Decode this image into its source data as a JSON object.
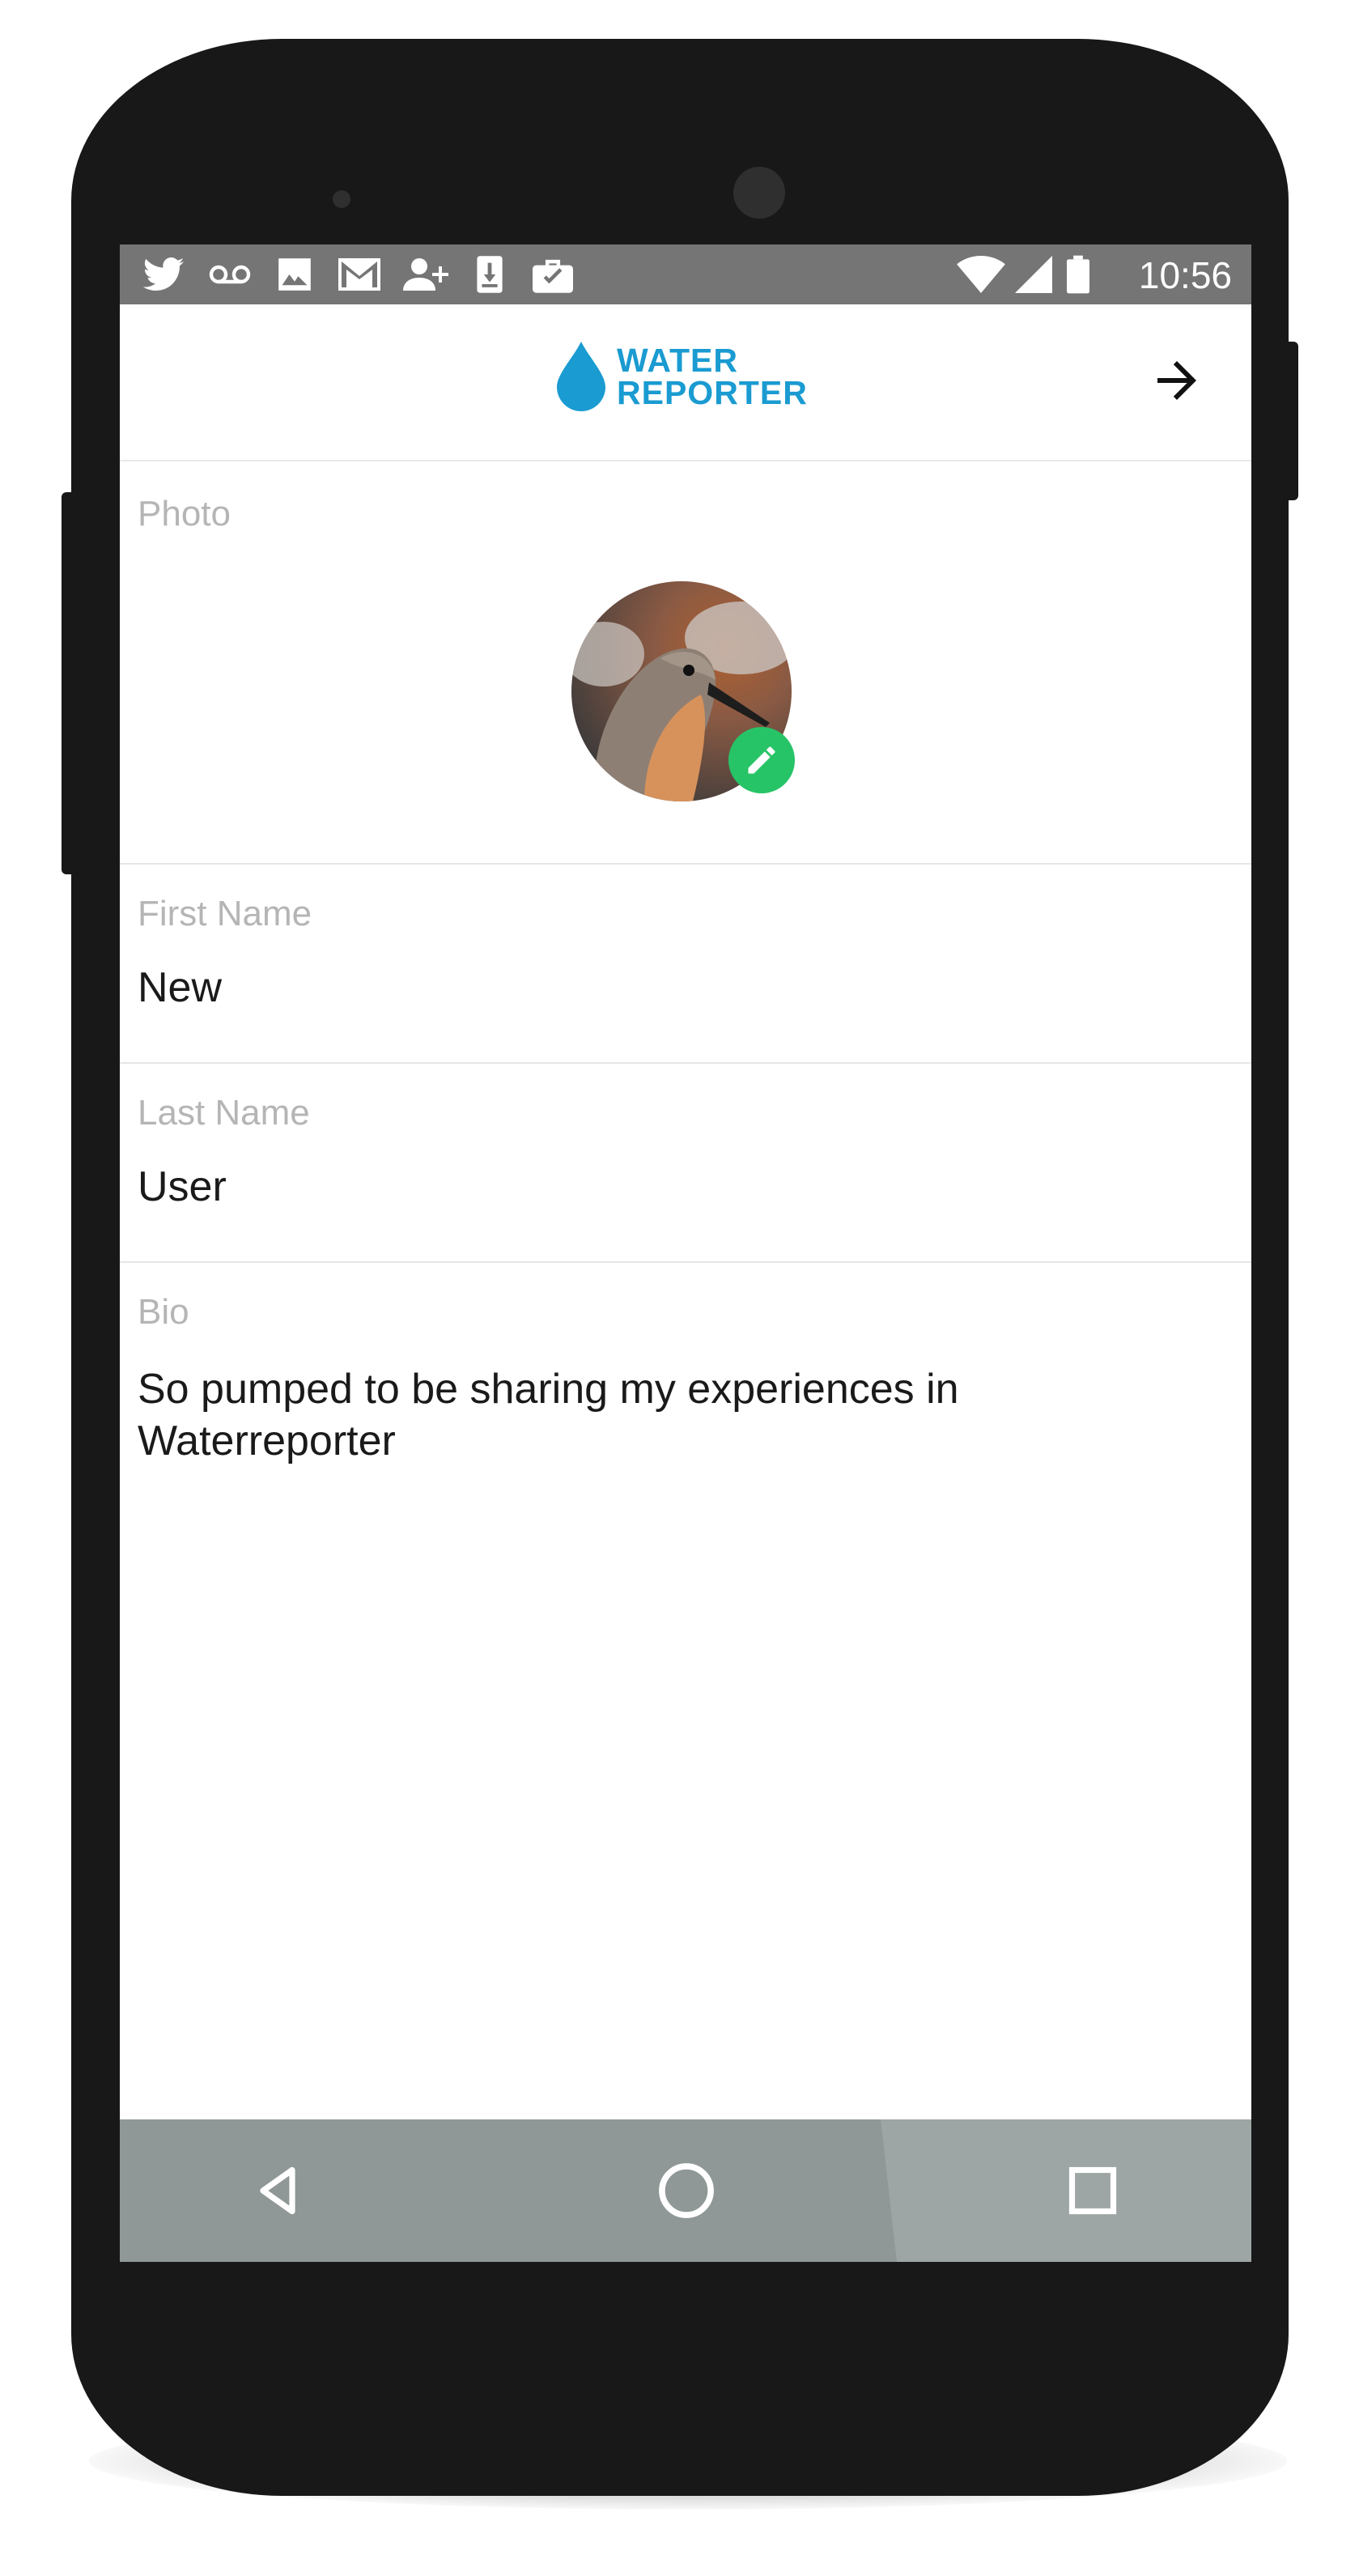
{
  "status_bar": {
    "time": "10:56",
    "left_icons": [
      "twitter-icon",
      "voicemail-icon",
      "image-icon",
      "gmail-icon",
      "add-person-icon",
      "download-icon",
      "work-briefcase-icon"
    ],
    "right_icons": [
      "wifi-icon",
      "signal-icon",
      "battery-icon"
    ]
  },
  "app_bar": {
    "logo_line1": "WATER",
    "logo_line2": "REPORTER",
    "brand_color": "#1a9bd1",
    "next_icon": "arrow-right-icon"
  },
  "form": {
    "photo_label": "Photo",
    "first_name_label": "First Name",
    "first_name_value": "New",
    "last_name_label": "Last Name",
    "last_name_value": "User",
    "bio_label": "Bio",
    "bio_value": "So pumped to be sharing my experiences in Waterreporter",
    "edit_badge_color": "#27c467"
  },
  "nav_bar": {
    "icons": [
      "back-triangle-icon",
      "home-circle-icon",
      "recents-square-icon"
    ]
  }
}
